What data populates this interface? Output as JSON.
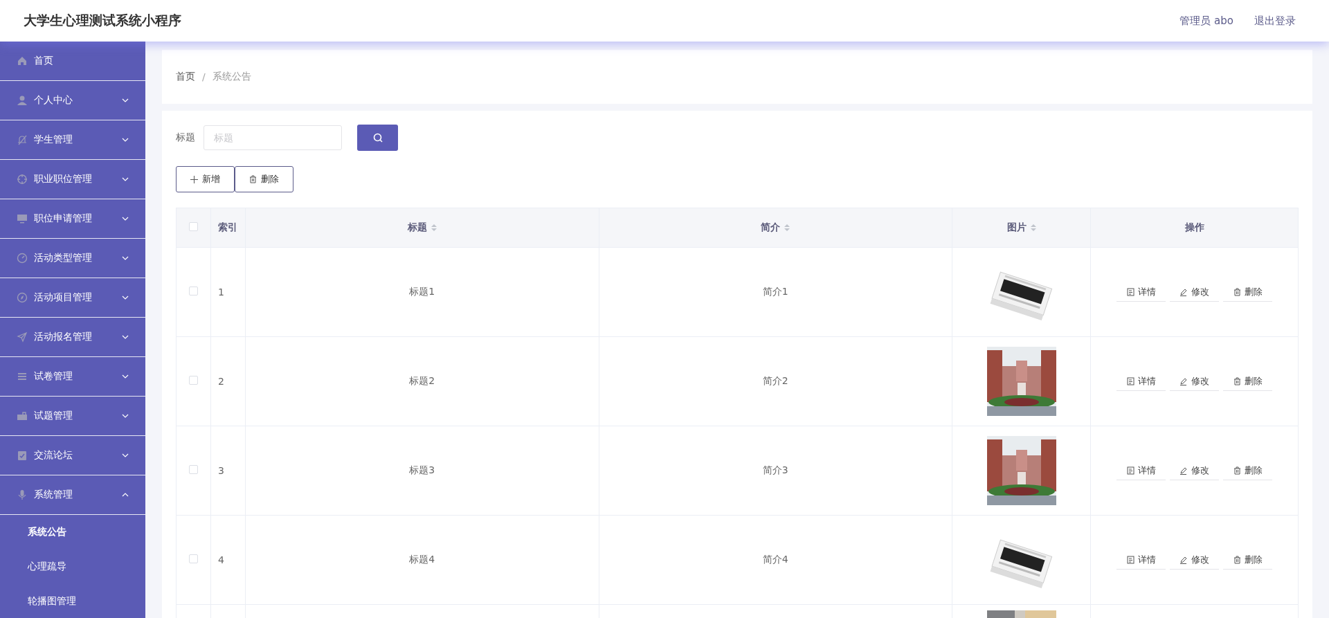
{
  "header": {
    "title": "大学生心理测试系统小程序",
    "user": "管理员 abo",
    "logout": "退出登录"
  },
  "sidebar": {
    "items": [
      {
        "label": "首页"
      },
      {
        "label": "个人中心",
        "expanded": false
      },
      {
        "label": "学生管理",
        "expanded": false
      },
      {
        "label": "职业职位管理",
        "expanded": false
      },
      {
        "label": "职位申请管理",
        "expanded": false
      },
      {
        "label": "活动类型管理",
        "expanded": false
      },
      {
        "label": "活动项目管理",
        "expanded": false
      },
      {
        "label": "活动报名管理",
        "expanded": false
      },
      {
        "label": "试卷管理",
        "expanded": false
      },
      {
        "label": "试题管理",
        "expanded": false
      },
      {
        "label": "交流论坛",
        "expanded": false
      },
      {
        "label": "系统管理",
        "expanded": true,
        "children": [
          {
            "label": "系统公告",
            "selected": true
          },
          {
            "label": "心理疏导",
            "selected": false
          },
          {
            "label": "轮播图管理",
            "selected": false
          }
        ]
      }
    ]
  },
  "breadcrumb": [
    "首页",
    "/",
    "系统公告"
  ],
  "search": {
    "label": "标题",
    "placeholder": "标题"
  },
  "actions": [
    {
      "kind": "add",
      "label": "新增"
    },
    {
      "kind": "delete",
      "label": "删除"
    }
  ],
  "table": {
    "columns": [
      {
        "kind": "check",
        "checked": false
      },
      {
        "kind": "text",
        "label": "索引",
        "sortable": false
      },
      {
        "kind": "text",
        "label": "标题",
        "sortable": true
      },
      {
        "kind": "text",
        "label": "简介",
        "sortable": true
      },
      {
        "kind": "text",
        "label": "图片",
        "sortable": true
      },
      {
        "kind": "text",
        "label": "操作",
        "sortable": false
      }
    ],
    "rows": [
      {
        "checked": false,
        "index": "1",
        "title": "标题1",
        "intro": "简介1",
        "image": {
          "kind": "picture"
        },
        "ops": [
          {
            "kind": "detail",
            "label": "详情"
          },
          {
            "kind": "edit",
            "label": "修改"
          },
          {
            "kind": "delete",
            "label": "删除"
          }
        ]
      },
      {
        "checked": false,
        "index": "2",
        "title": "标题2",
        "intro": "简介2",
        "image": {
          "kind": "picture"
        },
        "ops": [
          {
            "kind": "detail",
            "label": "详情"
          },
          {
            "kind": "edit",
            "label": "修改"
          },
          {
            "kind": "delete",
            "label": "删除"
          }
        ]
      },
      {
        "checked": false,
        "index": "3",
        "title": "标题3",
        "intro": "简介3",
        "image": {
          "kind": "picture"
        },
        "ops": [
          {
            "kind": "detail",
            "label": "详情"
          },
          {
            "kind": "edit",
            "label": "修改"
          },
          {
            "kind": "delete",
            "label": "删除"
          }
        ]
      },
      {
        "checked": false,
        "index": "4",
        "title": "标题4",
        "intro": "简介4",
        "image": {
          "kind": "picture"
        },
        "ops": [
          {
            "kind": "detail",
            "label": "详情"
          },
          {
            "kind": "edit",
            "label": "修改"
          },
          {
            "kind": "delete",
            "label": "删除"
          }
        ]
      },
      {
        "image": {
          "kind": "picture"
        }
      }
    ]
  }
}
